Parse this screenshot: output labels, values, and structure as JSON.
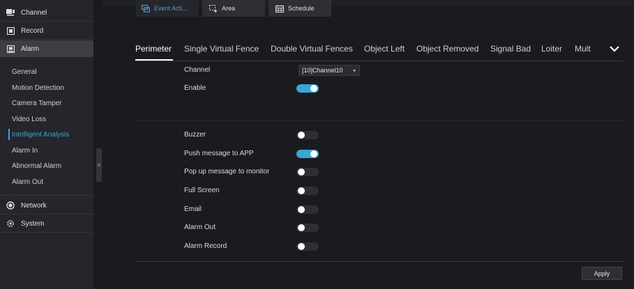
{
  "sidebar": {
    "top_items": [
      {
        "label": "Channel",
        "icon": "channel-icon"
      },
      {
        "label": "Record",
        "icon": "record-icon"
      },
      {
        "label": "Alarm",
        "icon": "alarm-icon"
      }
    ],
    "alarm_subitems": [
      {
        "label": "General"
      },
      {
        "label": "Motion Detection"
      },
      {
        "label": "Camera Tamper"
      },
      {
        "label": "Video Loss"
      },
      {
        "label": "Intelligent Analysis"
      },
      {
        "label": "Alarm In"
      },
      {
        "label": "Abnormal Alarm"
      },
      {
        "label": "Alarm Out"
      }
    ],
    "bottom_items": [
      {
        "label": "Network",
        "icon": "network-icon"
      },
      {
        "label": "System",
        "icon": "system-icon"
      }
    ],
    "collapse_glyph": "<"
  },
  "tabs": [
    {
      "label": "Perimeter"
    },
    {
      "label": "Single Virtual Fence"
    },
    {
      "label": "Double Virtual Fences"
    },
    {
      "label": "Object Left"
    },
    {
      "label": "Object Removed"
    },
    {
      "label": "Signal Bad"
    },
    {
      "label": "Loiter"
    },
    {
      "label": "Mult"
    }
  ],
  "form": {
    "channel_label": "Channel",
    "channel_value": "[10]Channel10",
    "enable_label": "Enable",
    "enable_on": true
  },
  "subtabs": [
    {
      "label": "Event Acti...",
      "icon": "event-action-icon"
    },
    {
      "label": "Area",
      "icon": "area-icon"
    },
    {
      "label": "Schedule",
      "icon": "schedule-icon"
    }
  ],
  "actions": [
    {
      "label": "Buzzer",
      "on": false
    },
    {
      "label": "Push message to APP",
      "on": true
    },
    {
      "label": "Pop up message to monitor",
      "on": false
    },
    {
      "label": "Full Screen",
      "on": false
    },
    {
      "label": "Email",
      "on": false
    },
    {
      "label": "Alarm Out",
      "on": false
    },
    {
      "label": "Alarm Record",
      "on": false
    }
  ],
  "apply_label": "Apply",
  "colors": {
    "accent": "#3aa6d6",
    "background": "#1a1b1f",
    "sidebar": "#25262b"
  }
}
